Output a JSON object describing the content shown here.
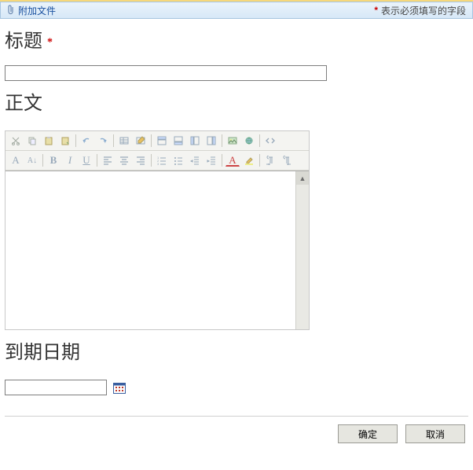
{
  "header": {
    "attach_label": "附加文件",
    "required_note": "表示必须填写的字段"
  },
  "fields": {
    "title_label": "标题",
    "title_value": "",
    "body_label": "正文",
    "body_value": "",
    "date_label": "到期日期",
    "date_value": ""
  },
  "toolbar": {
    "row1": [
      "cut",
      "copy",
      "paste",
      "paste-special",
      "|",
      "undo",
      "redo",
      "|",
      "insert-table",
      "edit-table",
      "|",
      "insert-row-above",
      "insert-row-below",
      "insert-col-left",
      "insert-col-right",
      "|",
      "image",
      "link",
      "|",
      "html-mode"
    ],
    "row2": [
      "font-size",
      "font-family",
      "bold",
      "italic",
      "underline",
      "|",
      "align-left",
      "align-center",
      "align-right",
      "|",
      "ordered-list",
      "unordered-list",
      "outdent",
      "indent",
      "|",
      "font-color",
      "bg-color",
      "|",
      "ltr",
      "rtl"
    ]
  },
  "buttons": {
    "ok": "确定",
    "cancel": "取消"
  },
  "icons": {
    "font_size": "A",
    "font_family": "A↓",
    "bold": "B",
    "italic": "I",
    "underline": "U"
  }
}
